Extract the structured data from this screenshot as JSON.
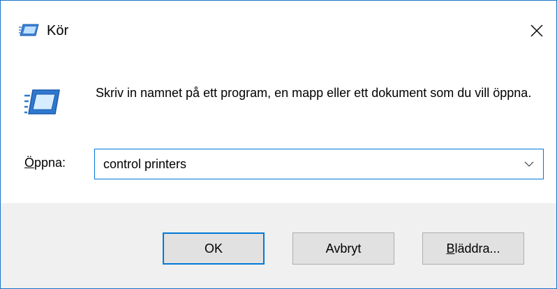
{
  "window": {
    "title": "Kör",
    "close_glyph": "✕"
  },
  "dialog": {
    "description": "Skriv in namnet på ett program, en mapp eller ett dokument som du vill öppna.",
    "open_label_mnemonic": "Ö",
    "open_label_rest": "ppna:",
    "open_value": "control printers"
  },
  "buttons": {
    "ok": "OK",
    "cancel": "Avbryt",
    "browse_mnemonic": "B",
    "browse_rest": "läddra..."
  },
  "icons": {
    "title": "run-icon",
    "dialog": "run-icon",
    "close": "close-icon",
    "dropdown": "chevron-down-icon"
  },
  "colors": {
    "accent": "#0078d7",
    "footer_bg": "#f0f0f0",
    "button_bg": "#e1e1e1"
  }
}
